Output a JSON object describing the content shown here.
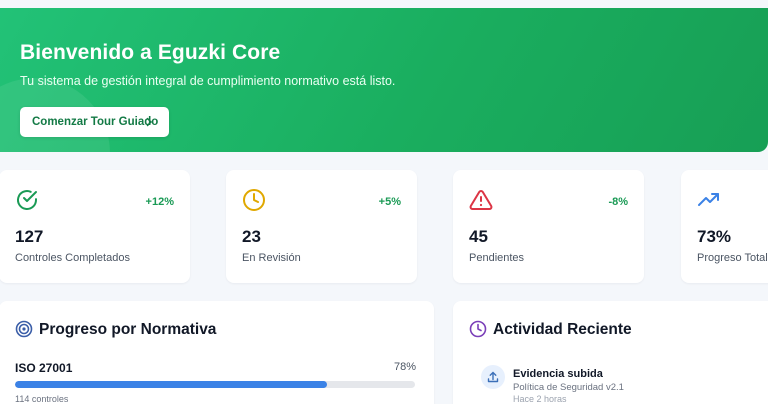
{
  "hero": {
    "title": "Bienvenido a Eguzki Core",
    "subtitle": "Tu sistema de gestión integral de cumplimiento normativo está listo.",
    "tour_button": "Comenzar Tour Guiado",
    "bg_color": "#1fb866"
  },
  "stats": [
    {
      "icon": "check-circle-icon",
      "value": "127",
      "label": "Controles Completados",
      "change": "+12%",
      "color": "#1a9a55"
    },
    {
      "icon": "clock-icon",
      "value": "23",
      "label": "En Revisión",
      "change": "+5%",
      "color": "#e0a800"
    },
    {
      "icon": "alert-triangle-icon",
      "value": "45",
      "label": "Pendientes",
      "change": "-8%",
      "color": "#dc3545"
    },
    {
      "icon": "trending-up-icon",
      "value": "73%",
      "label": "Progreso Total",
      "change": "",
      "color": "#3b82e6"
    }
  ],
  "progress_panel": {
    "title": "Progreso por Normativa",
    "icon": "target-icon",
    "items": [
      {
        "name": "ISO 27001",
        "percent_label": "78%",
        "percent": 78,
        "sub": "114 controles"
      }
    ]
  },
  "activity_panel": {
    "title": "Actividad Reciente",
    "icon": "clock-icon",
    "items": [
      {
        "icon": "upload-icon",
        "title": "Evidencia subida",
        "subtitle": "Política de Seguridad v2.1",
        "time": "Hace 2 horas"
      }
    ]
  }
}
